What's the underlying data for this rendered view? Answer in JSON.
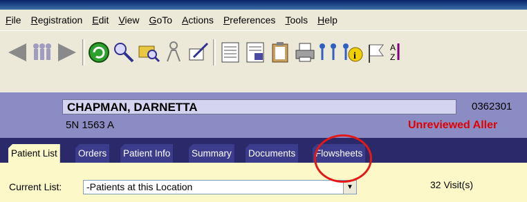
{
  "menu": [
    "File",
    "Registration",
    "Edit",
    "View",
    "GoTo",
    "Actions",
    "Preferences",
    "Tools",
    "Help"
  ],
  "patient": {
    "name": "CHAPMAN, DARNETTA",
    "location": "5N 1563 A",
    "mrn": "0362301",
    "alert": "Unreviewed Aller"
  },
  "tabs": [
    "Patient List",
    "Orders",
    "Patient Info",
    "Summary",
    "Documents",
    "Flowsheets"
  ],
  "list": {
    "label": "Current List:",
    "value": "-Patients at this Location",
    "visits": "32 Visit(s)"
  },
  "colors": {
    "alert": "#e00000",
    "annotation": "#e51818",
    "header_bg": "#8c8cc4",
    "tab_bg": "#3c3c8c"
  }
}
